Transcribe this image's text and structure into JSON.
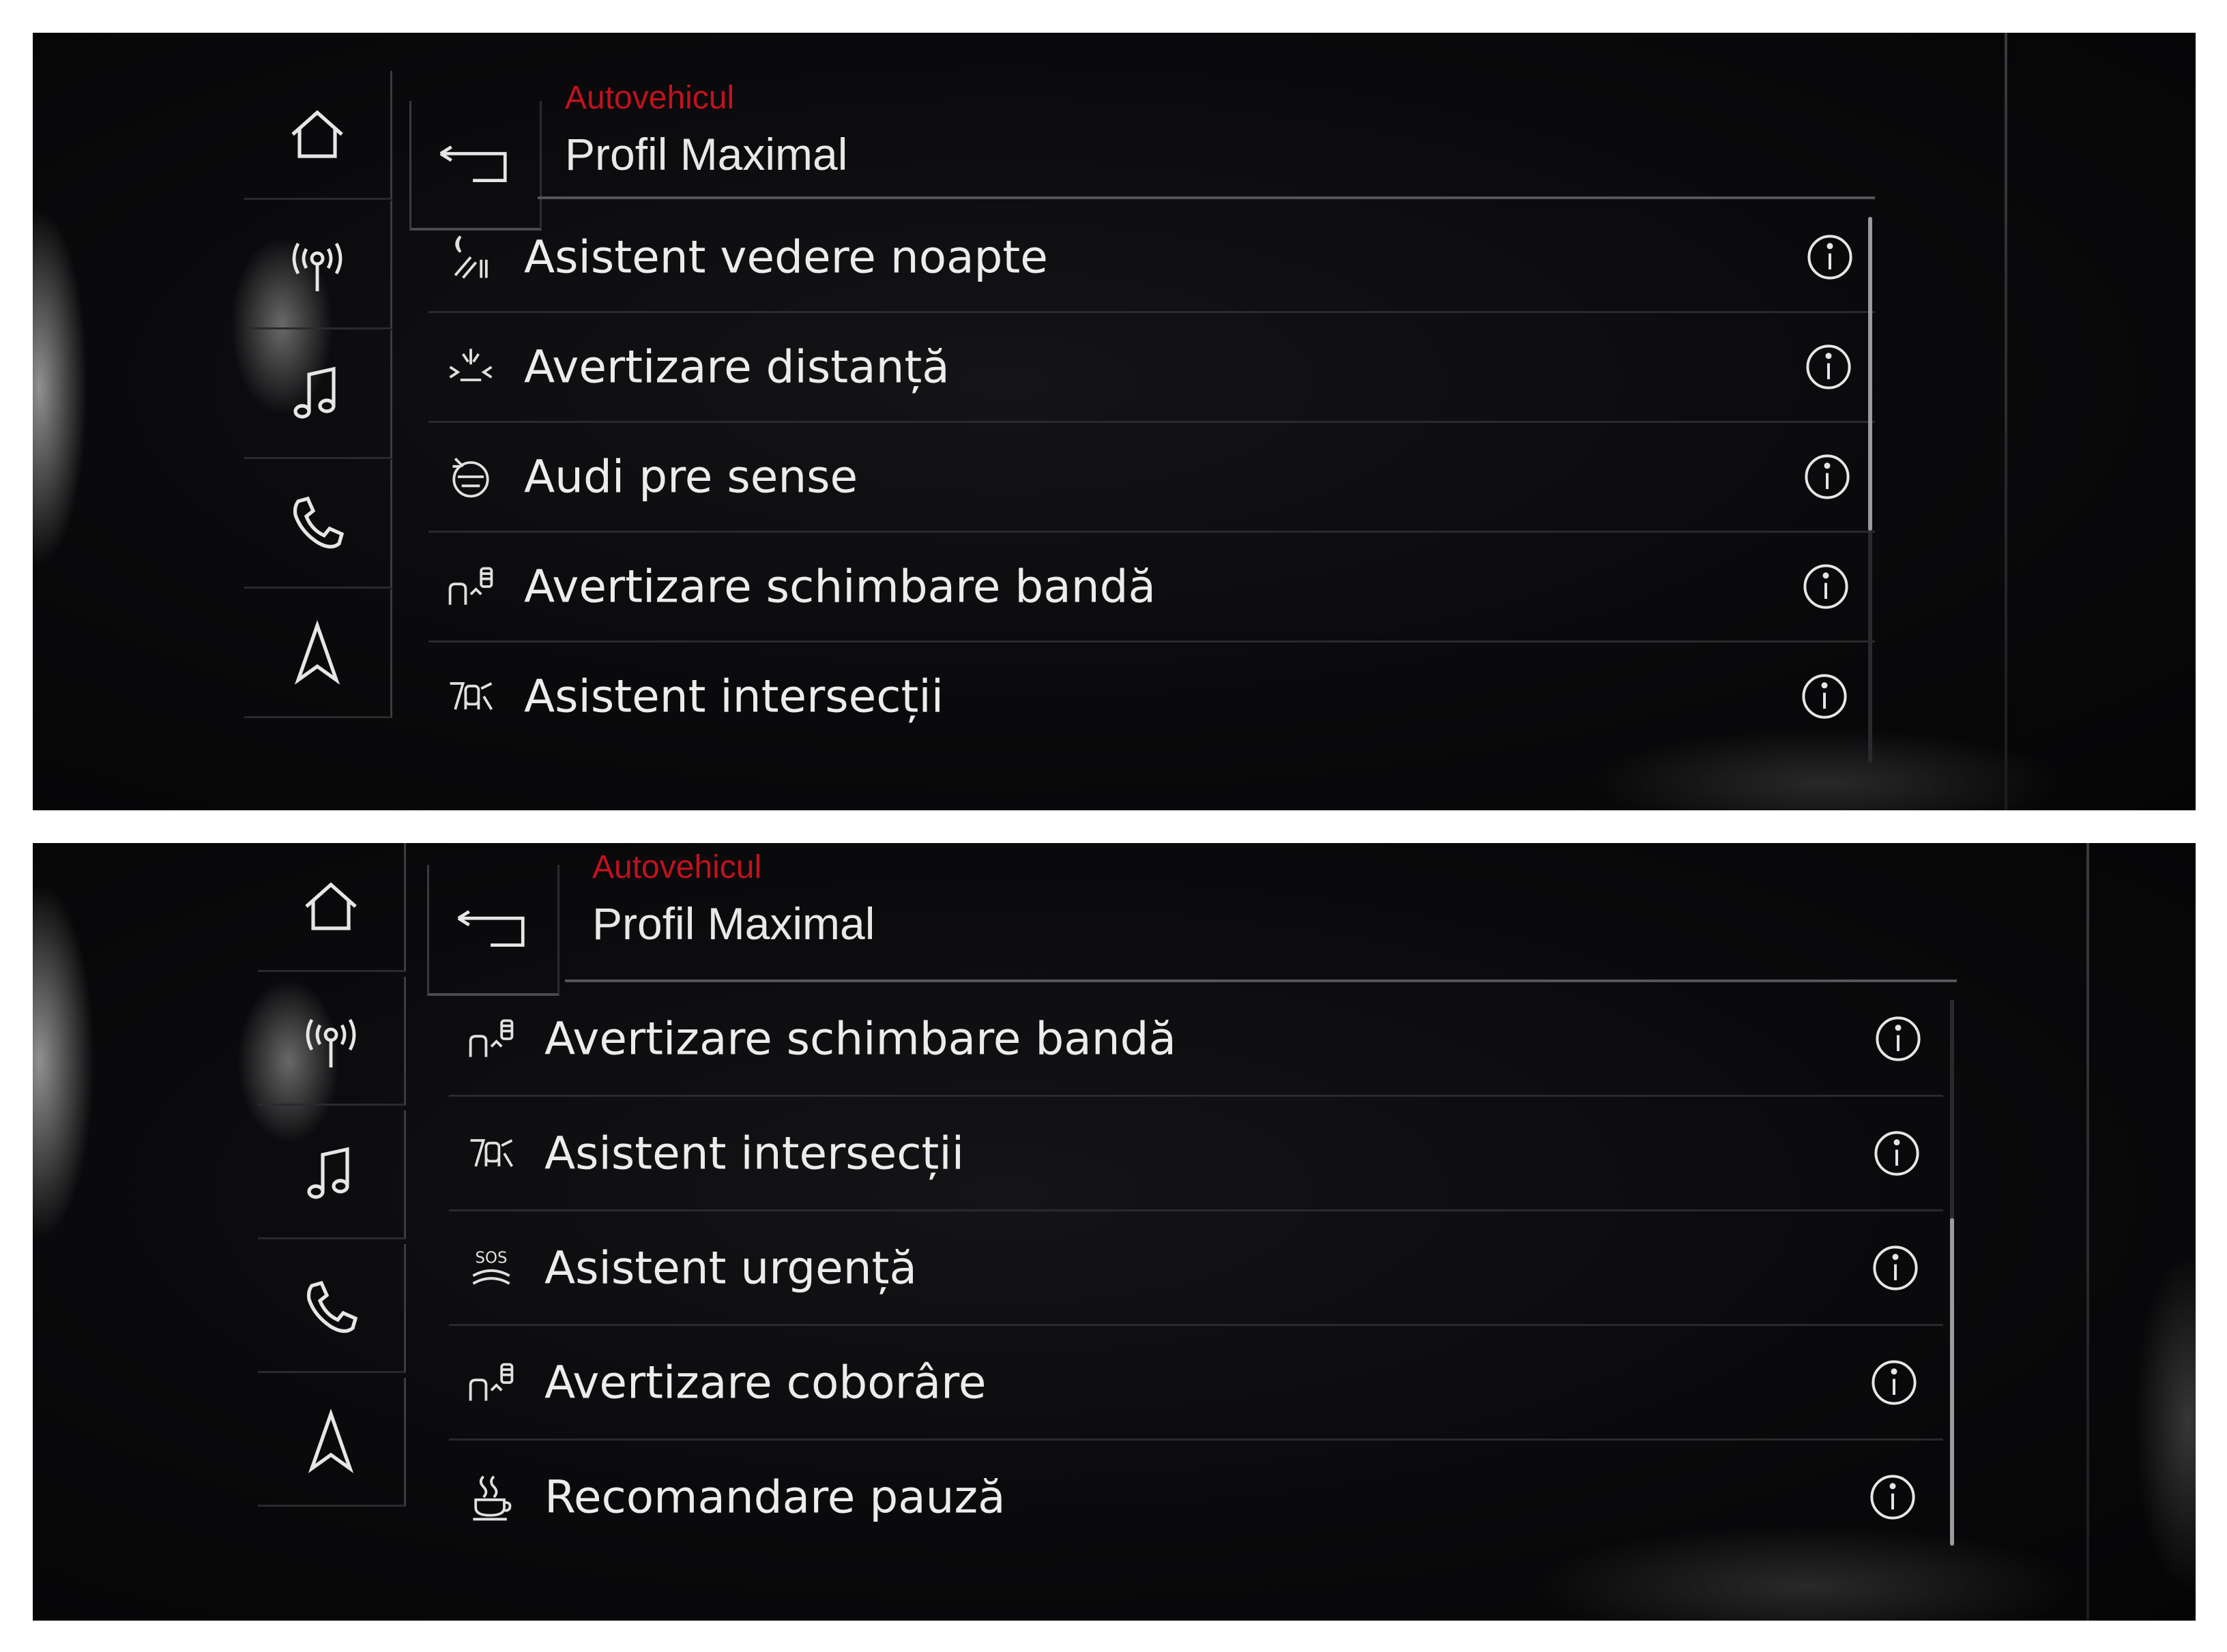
{
  "panels": [
    {
      "breadcrumb": "Autovehicul",
      "title": "Profil Maximal",
      "items": [
        {
          "label": "Asistent vedere noapte",
          "icon": "night-vision-icon"
        },
        {
          "label": "Avertizare distanță",
          "icon": "distance-warning-icon"
        },
        {
          "label": "Audi pre sense",
          "icon": "pre-sense-icon"
        },
        {
          "label": "Avertizare schimbare bandă",
          "icon": "lane-change-icon"
        },
        {
          "label": "Asistent intersecții",
          "icon": "intersection-icon"
        }
      ],
      "scroll_position": 0.0
    },
    {
      "breadcrumb": "Autovehicul",
      "title": "Profil Maximal",
      "items": [
        {
          "label": "Avertizare schimbare bandă",
          "icon": "lane-change-icon"
        },
        {
          "label": "Asistent intersecții",
          "icon": "intersection-icon"
        },
        {
          "label": "Asistent urgență",
          "icon": "sos-icon"
        },
        {
          "label": "Avertizare coborâre",
          "icon": "exit-warning-icon"
        },
        {
          "label": "Recomandare pauză",
          "icon": "coffee-cup-icon"
        }
      ],
      "scroll_position": 1.0
    }
  ],
  "sidebar": [
    "home-icon",
    "radio-icon",
    "music-note-icon",
    "phone-icon",
    "navigation-icon"
  ],
  "colors": {
    "accent": "#c2121c",
    "text": "#ececec",
    "background": "#0a0a0c"
  }
}
